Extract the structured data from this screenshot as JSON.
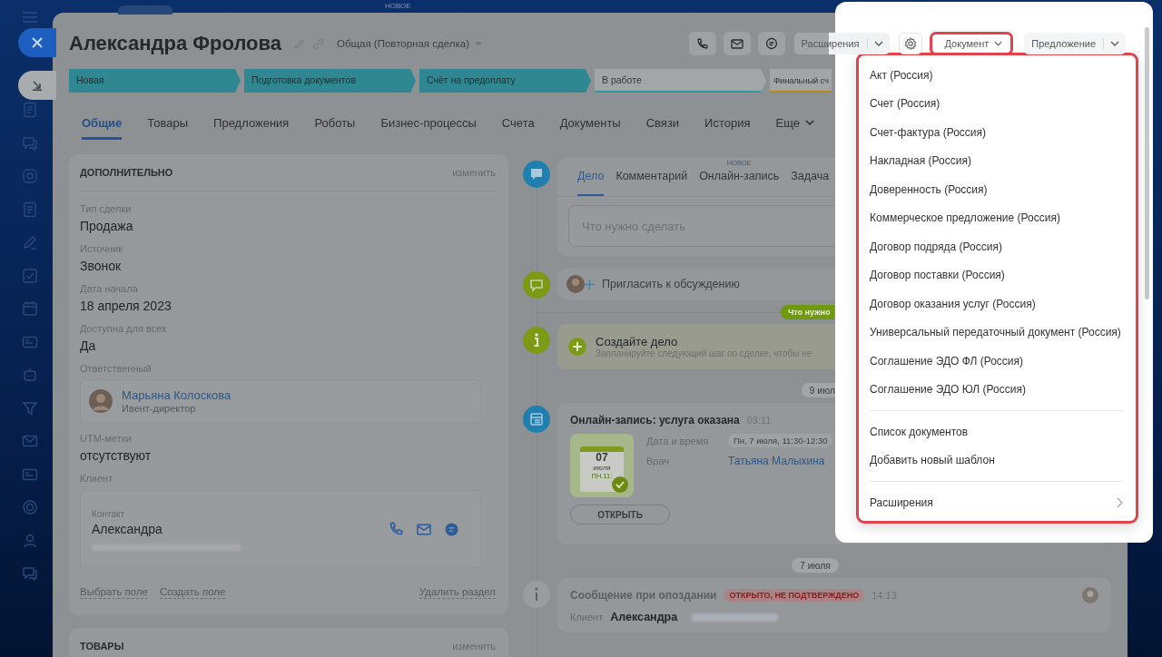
{
  "top_badge": "НОВОЕ",
  "deal": {
    "title": "Александра Фролова",
    "category": "Общая (Повторная сделка)"
  },
  "toolbar": {
    "extensions": "Расширения",
    "document": "Документ",
    "document_highlighted": true,
    "offer": "Предложение"
  },
  "stages": [
    {
      "label": "Новая",
      "color": "#2f8791",
      "reached": true
    },
    {
      "label": "Подготовка документов",
      "color": "#2f8791",
      "reached": true
    },
    {
      "label": "Счёт на предоплату",
      "color": "#2f8791",
      "reached": true
    },
    {
      "label": "В работе",
      "color": "#2f9a9e",
      "reached": false
    },
    {
      "label": "Финальный сч",
      "color": "#b38a1e",
      "reached": false
    }
  ],
  "tabs": [
    {
      "label": "Общие",
      "selected": true,
      "kind": "tab"
    },
    {
      "label": "Товары",
      "selected": false,
      "kind": "tab"
    },
    {
      "label": "Предложения",
      "selected": false,
      "kind": "tab"
    },
    {
      "label": "Роботы",
      "selected": false,
      "kind": "tab"
    },
    {
      "label": "Бизнес-процессы",
      "selected": false,
      "kind": "tab"
    },
    {
      "label": "Счета",
      "selected": false,
      "kind": "tab"
    },
    {
      "label": "Документы",
      "selected": false,
      "kind": "tab"
    },
    {
      "label": "Связи",
      "selected": false,
      "kind": "tab"
    },
    {
      "label": "История",
      "selected": false,
      "kind": "tab"
    },
    {
      "label": "Еще",
      "selected": false,
      "kind": "more"
    }
  ],
  "details": {
    "title": "ДОПОЛНИТЕЛЬНО",
    "edit": "изменить",
    "fields": [
      {
        "kind": "text",
        "label": "Тип сделки",
        "value": "Продажа"
      },
      {
        "kind": "text",
        "label": "Источник",
        "value": "Звонок"
      },
      {
        "kind": "text",
        "label": "Дата начала",
        "value": "18 апреля 2023"
      },
      {
        "kind": "text",
        "label": "Доступна для всех",
        "value": "Да"
      },
      {
        "kind": "person",
        "label": "Ответственный",
        "name": "Марьяна Колоскова",
        "role": "Ивент-директор"
      },
      {
        "kind": "text",
        "label": "UTM-метки",
        "value": "отсутствуют"
      },
      {
        "kind": "client",
        "label": "Клиент",
        "sublabel": "Контакт",
        "name": "Александра"
      }
    ],
    "links": [
      "Выбрать поле",
      "Создать поле"
    ],
    "delete": "Удалить раздел"
  },
  "products": {
    "title": "ТОВАРЫ",
    "edit": "изменить"
  },
  "composer": {
    "tabs": [
      {
        "label": "Дело",
        "selected": true
      },
      {
        "label": "Комментарий",
        "selected": false
      },
      {
        "label": "Онлайн-запись",
        "selected": false,
        "badge": "НОВОЕ"
      },
      {
        "label": "Задача",
        "selected": false
      }
    ],
    "placeholder": "Что нужно сделать"
  },
  "invite": "Пригласить к обсуждению",
  "todo_pill": "Что нужно",
  "create_task": {
    "title": "Создайте дело",
    "hint": "Запланируйте следующий шаг по сделке, чтобы не"
  },
  "date_1": "9 июл",
  "booking": {
    "title": "Онлайн-запись: услуга оказана",
    "time": "03:11",
    "calendar": {
      "day": "07",
      "month": "июля",
      "weekday": "ПН.11:"
    },
    "fields": [
      {
        "kind": "chip",
        "label": "Дата и время",
        "value": "Пн, 7 июля, 11:30-12:30"
      },
      {
        "kind": "link",
        "label": "Врач",
        "value": "Татьяна Малыхина"
      }
    ],
    "button": "ОТКРЫТЬ"
  },
  "date_2": "7 июля",
  "message": {
    "title": "Сообщение при опоздании",
    "status": "ОТКРЫТО, НЕ ПОДТВЕРЖДЕНО",
    "time": "14:13",
    "client_label": "Клиент",
    "client": "Александра"
  },
  "menu": {
    "highlighted": true,
    "groups": [
      [
        {
          "label": "Акт (Россия)",
          "kind": "item"
        },
        {
          "label": "Счет (Россия)",
          "kind": "item"
        },
        {
          "label": "Счет-фактура (Россия)",
          "kind": "item"
        },
        {
          "label": "Накладная (Россия)",
          "kind": "item"
        },
        {
          "label": "Доверенность (Россия)",
          "kind": "item"
        },
        {
          "label": "Коммерческое предложение (Россия)",
          "kind": "item"
        },
        {
          "label": "Договор подряда (Россия)",
          "kind": "item"
        },
        {
          "label": "Договор поставки (Россия)",
          "kind": "item"
        },
        {
          "label": "Договор оказания услуг (Россия)",
          "kind": "item"
        },
        {
          "label": "Универсальный передаточный документ (Россия)",
          "kind": "item"
        },
        {
          "label": "Соглашение ЭДО ФЛ (Россия)",
          "kind": "item"
        },
        {
          "label": "Соглашение ЭДО ЮЛ (Россия)",
          "kind": "item"
        }
      ],
      [
        {
          "label": "Список документов",
          "kind": "item"
        },
        {
          "label": "Добавить новый шаблон",
          "kind": "item"
        }
      ],
      [
        {
          "label": "Расширения",
          "kind": "submenu"
        }
      ]
    ]
  }
}
